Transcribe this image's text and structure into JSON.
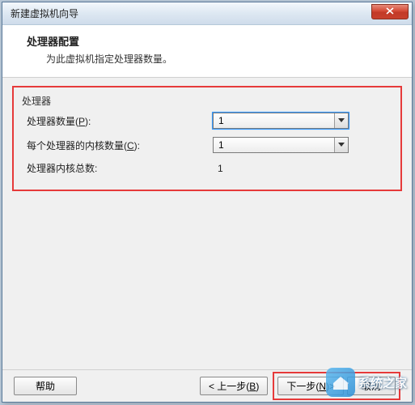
{
  "window": {
    "title": "新建虚拟机向导"
  },
  "header": {
    "title": "处理器配置",
    "subtitle": "为此虚拟机指定处理器数量。"
  },
  "section": {
    "label": "处理器",
    "rows": {
      "processors": {
        "label_pre": "处理器数量(",
        "key": "P",
        "label_post": "):",
        "value": "1"
      },
      "cores": {
        "label_pre": "每个处理器的内核数量(",
        "key": "C",
        "label_post": "):",
        "value": "1"
      },
      "total": {
        "label": "处理器内核总数:",
        "value": "1"
      }
    }
  },
  "footer": {
    "help": "帮助",
    "back_pre": "< 上一步(",
    "back_key": "B",
    "back_post": ")",
    "next_pre": "下一步(",
    "next_key": "N",
    "next_post": ")>",
    "cancel": "取消"
  },
  "watermark": {
    "text": "系统之家"
  }
}
